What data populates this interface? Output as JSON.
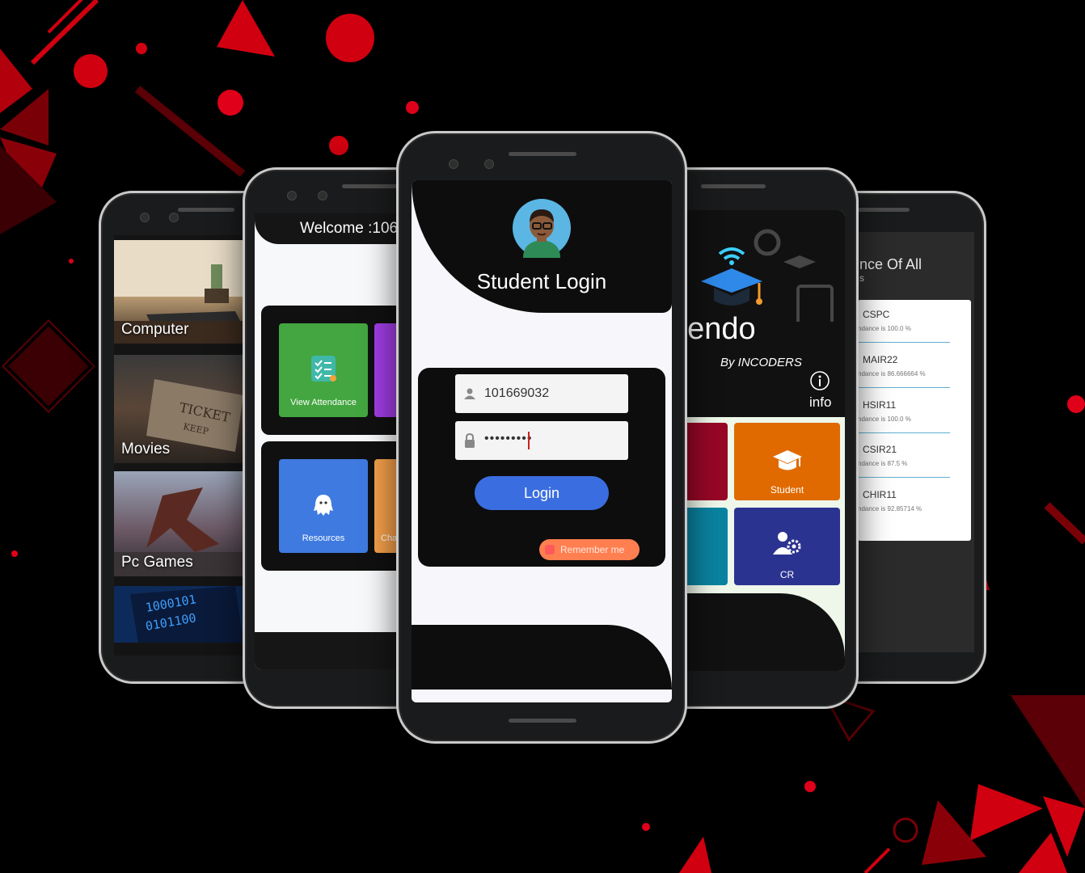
{
  "colors": {
    "background": "#000000",
    "accent_red": "#d90010",
    "login_blue": "#3a6ee0",
    "remember_orange": "#ff7f50"
  },
  "phone_categories": {
    "items": [
      {
        "label": "Computer"
      },
      {
        "label": "Movies"
      },
      {
        "label": "Pc Games"
      }
    ]
  },
  "phone_dashboard": {
    "welcome": "Welcome :106",
    "tiles": [
      {
        "label": "View Attendance",
        "icon": "checklist-icon"
      },
      {
        "label": "Resources",
        "icon": "ghost-icon"
      },
      {
        "label": "Cha",
        "icon": ""
      }
    ]
  },
  "phone_login": {
    "title": "Student Login",
    "username_value": "101669032",
    "password_value": "•••••••••",
    "login_label": "Login",
    "remember_label": "Remember me"
  },
  "phone_home": {
    "app_name": "ttendo",
    "byline": "By INCODERS",
    "info_label": "info",
    "tiles": [
      {
        "label": "Student",
        "icon": "graduation-cap-icon"
      },
      {
        "label": "CR",
        "icon": "people-gear-icon"
      }
    ]
  },
  "phone_attendance": {
    "title": "nce Of All",
    "subtitle": "s",
    "rows": [
      {
        "code": "CSPC",
        "text": "ndance is 100.0 %"
      },
      {
        "code": "MAIR22",
        "text": "ndance is 86.666664 %"
      },
      {
        "code": "HSIR11",
        "text": "ndance is 100.0 %"
      },
      {
        "code": "CSIR21",
        "text": "ndance is 87.5 %"
      },
      {
        "code": "CHIR11",
        "text": "ndance is 92.85714 %"
      }
    ]
  }
}
